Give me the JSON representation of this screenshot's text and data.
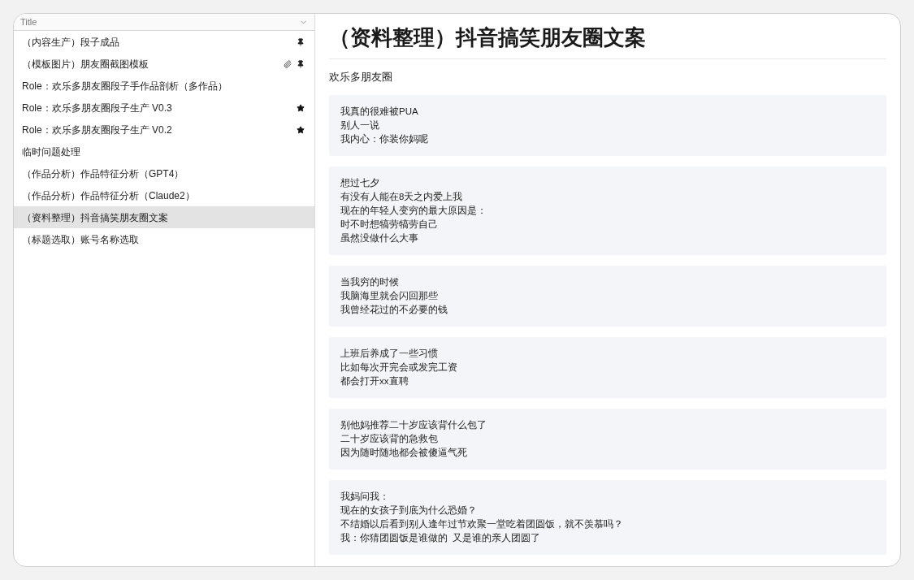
{
  "sidebar": {
    "column_header": "Title",
    "items": [
      {
        "label": "（内容生产）段子成品",
        "pinned": true,
        "attachment": false,
        "starred": false,
        "selected": false
      },
      {
        "label": "（模板图片）朋友圈截图模板",
        "pinned": true,
        "attachment": true,
        "starred": false,
        "selected": false
      },
      {
        "label": "Role：欢乐多朋友圈段子手作品剖析（多作品）",
        "pinned": false,
        "attachment": false,
        "starred": false,
        "selected": false
      },
      {
        "label": "Role：欢乐多朋友圈段子生产 V0.3",
        "pinned": false,
        "attachment": false,
        "starred": true,
        "selected": false
      },
      {
        "label": "Role：欢乐多朋友圈段子生产 V0.2",
        "pinned": false,
        "attachment": false,
        "starred": true,
        "selected": false
      },
      {
        "label": "临时问题处理",
        "pinned": false,
        "attachment": false,
        "starred": false,
        "selected": false
      },
      {
        "label": "（作品分析）作品特征分析（GPT4）",
        "pinned": false,
        "attachment": false,
        "starred": false,
        "selected": false
      },
      {
        "label": "（作品分析）作品特征分析（Claude2）",
        "pinned": false,
        "attachment": false,
        "starred": false,
        "selected": false
      },
      {
        "label": "（资料整理）抖音搞笑朋友圈文案",
        "pinned": false,
        "attachment": false,
        "starred": false,
        "selected": true
      },
      {
        "label": "（标题选取）账号名称选取",
        "pinned": false,
        "attachment": false,
        "starred": false,
        "selected": false
      }
    ]
  },
  "document": {
    "title": "（资料整理）抖音搞笑朋友圈文案",
    "subtitle": "欢乐多朋友圈",
    "blocks": [
      [
        "我真的很难被PUA",
        "别人一说",
        "我内心：你装你妈呢"
      ],
      [
        "想过七夕",
        "有没有人能在8天之内爱上我",
        "现在的年轻人变穷的最大原因是：",
        "时不时想犒劳犒劳自己",
        "虽然没做什么大事"
      ],
      [
        "当我穷的时候",
        "我脑海里就会闪回那些",
        "我曾经花过的不必要的钱"
      ],
      [
        "上班后养成了一些习惯",
        "比如每次开完会或发完工资",
        "都会打开xx直聘"
      ],
      [
        "别他妈推荐二十岁应该背什么包了",
        "二十岁应该背的急救包",
        "因为随时随地都会被傻逼气死"
      ],
      [
        "我妈问我：",
        "现在的女孩子到底为什么恐婚？",
        "不结婚以后看到别人逢年过节欢聚一堂吃着团圆饭，就不羡慕吗？",
        "我：你猜团圆饭是谁做的  又是谁的亲人团圆了"
      ]
    ]
  }
}
